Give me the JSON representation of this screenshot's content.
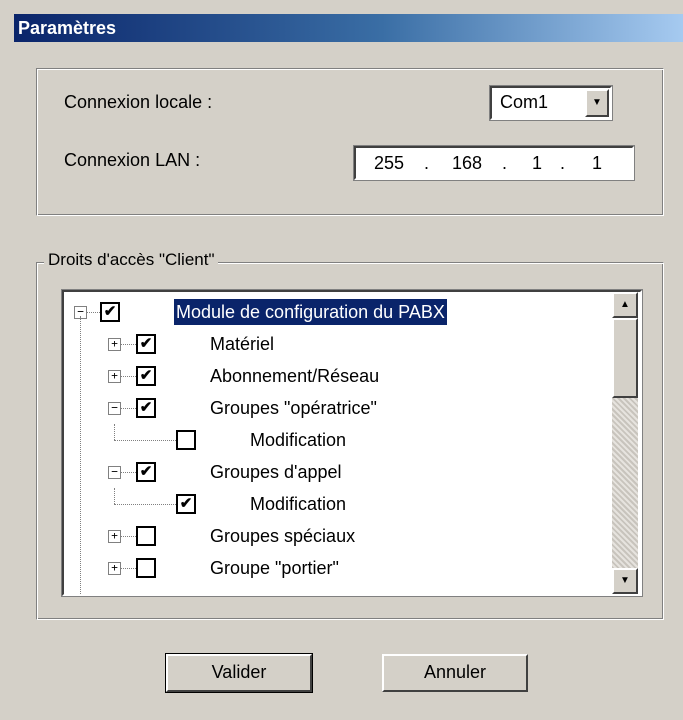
{
  "window": {
    "title": "Paramètres"
  },
  "connection": {
    "local_label": "Connexion locale :",
    "local_value": "Com1",
    "lan_label": "Connexion LAN :",
    "ip": [
      "255",
      "168",
      "1",
      "1"
    ],
    "ip_separator": "."
  },
  "access": {
    "legend": "Droits d'accès \"Client\"",
    "tree": [
      {
        "label": "Module de configuration du PABX",
        "checked": true,
        "expander": "minus",
        "level": 0,
        "selected": true
      },
      {
        "label": "Matériel",
        "checked": true,
        "expander": "plus",
        "level": 1
      },
      {
        "label": "Abonnement/Réseau",
        "checked": true,
        "expander": "plus",
        "level": 1
      },
      {
        "label": "Groupes \"opératrice\"",
        "checked": true,
        "expander": "minus",
        "level": 1
      },
      {
        "label": "Modification",
        "checked": false,
        "expander": "none",
        "level": 2
      },
      {
        "label": "Groupes d'appel",
        "checked": true,
        "expander": "minus",
        "level": 1
      },
      {
        "label": "Modification",
        "checked": true,
        "expander": "none",
        "level": 2
      },
      {
        "label": "Groupes spéciaux",
        "checked": false,
        "expander": "plus",
        "level": 1
      },
      {
        "label": "Groupe \"portier\"",
        "checked": false,
        "expander": "plus",
        "level": 1
      }
    ]
  },
  "buttons": {
    "ok": "Valider",
    "cancel": "Annuler"
  }
}
